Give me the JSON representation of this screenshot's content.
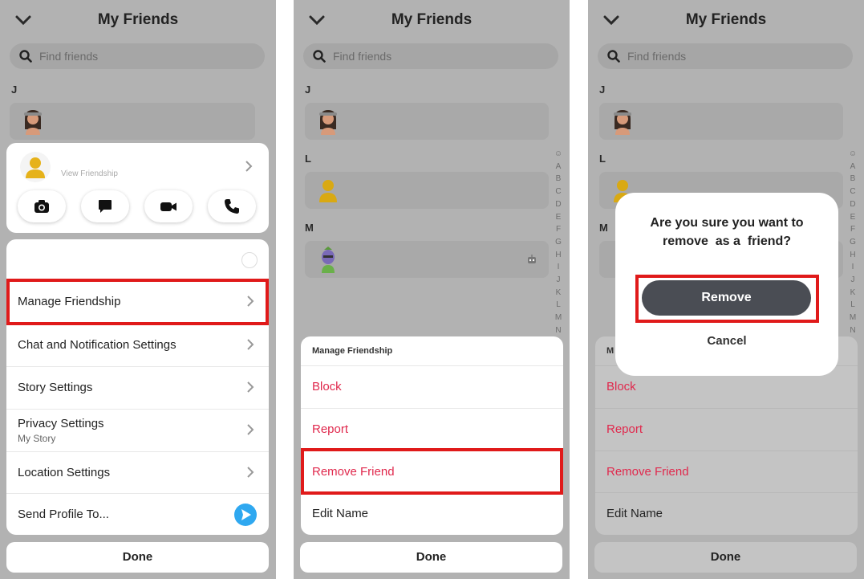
{
  "panels": [
    {
      "header": {
        "title": "My Friends"
      },
      "search": {
        "placeholder": "Find friends"
      },
      "section_j": "J",
      "profile_card": {
        "view_label": "View Friendship"
      },
      "settings": [
        {
          "label": "Manage Friendship"
        },
        {
          "label": "Chat and Notification Settings"
        },
        {
          "label": "Story Settings"
        },
        {
          "label": "Privacy Settings",
          "sub": "My Story"
        },
        {
          "label": "Location Settings"
        },
        {
          "label": "Send Profile To..."
        }
      ],
      "done_label": "Done"
    },
    {
      "header": {
        "title": "My Friends"
      },
      "search": {
        "placeholder": "Find friends"
      },
      "sections": [
        "J",
        "L",
        "M"
      ],
      "alphabet": [
        "☺",
        "A",
        "B",
        "C",
        "D",
        "E",
        "F",
        "G",
        "H",
        "I",
        "J",
        "K",
        "L",
        "M",
        "N"
      ],
      "sheet": {
        "title": "Manage Friendship",
        "items": [
          {
            "label": "Block"
          },
          {
            "label": "Report"
          },
          {
            "label": "Remove Friend"
          },
          {
            "label": "Edit Name"
          }
        ]
      },
      "done_label": "Done"
    },
    {
      "header": {
        "title": "My Friends"
      },
      "search": {
        "placeholder": "Find friends"
      },
      "sections": [
        "J",
        "L",
        "M"
      ],
      "alphabet": [
        "☺",
        "A",
        "B",
        "C",
        "D",
        "E",
        "F",
        "G",
        "H",
        "I",
        "J",
        "K",
        "L",
        "M",
        "N"
      ],
      "sheet": {
        "title": "M",
        "items": [
          {
            "label": "Block"
          },
          {
            "label": "Report"
          },
          {
            "label": "Remove Friend"
          },
          {
            "label": "Edit Name"
          }
        ]
      },
      "dialog": {
        "line1": "Are you sure you want to",
        "line2": "remove  as a  friend?",
        "remove_label": "Remove",
        "cancel_label": "Cancel"
      },
      "done_label": "Done"
    }
  ],
  "colors": {
    "highlight": "#e01a1a",
    "danger_text": "#e0294d",
    "send_blue": "#2fa8f0",
    "dim_bg": "#b2b2b2"
  }
}
